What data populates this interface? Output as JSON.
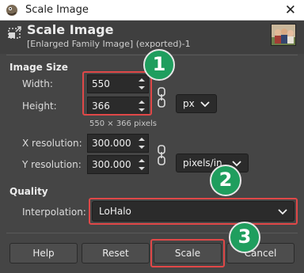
{
  "window": {
    "title": "Scale Image"
  },
  "header": {
    "title": "Scale Image",
    "subtitle": "[Enlarged Family Image] (exported)-1"
  },
  "image_size": {
    "section_label": "Image Size",
    "width_label": "Width:",
    "width_value": "550",
    "height_label": "Height:",
    "height_value": "366",
    "pixels_summary": "550 × 366 pixels",
    "unit": "px",
    "xres_label": "X resolution:",
    "xres_value": "300.000",
    "yres_label": "Y resolution:",
    "yres_value": "300.000",
    "res_unit": "pixels/in"
  },
  "quality": {
    "section_label": "Quality",
    "interpolation_label": "Interpolation:",
    "interpolation_value": "LoHalo"
  },
  "buttons": {
    "help": "Help",
    "reset": "Reset",
    "scale": "Scale",
    "cancel": "Cancel"
  },
  "markers": [
    "1",
    "2",
    "3"
  ],
  "colors": {
    "highlight": "#e04848",
    "marker": "#1f9e5e",
    "dialog_bg": "#454545"
  }
}
